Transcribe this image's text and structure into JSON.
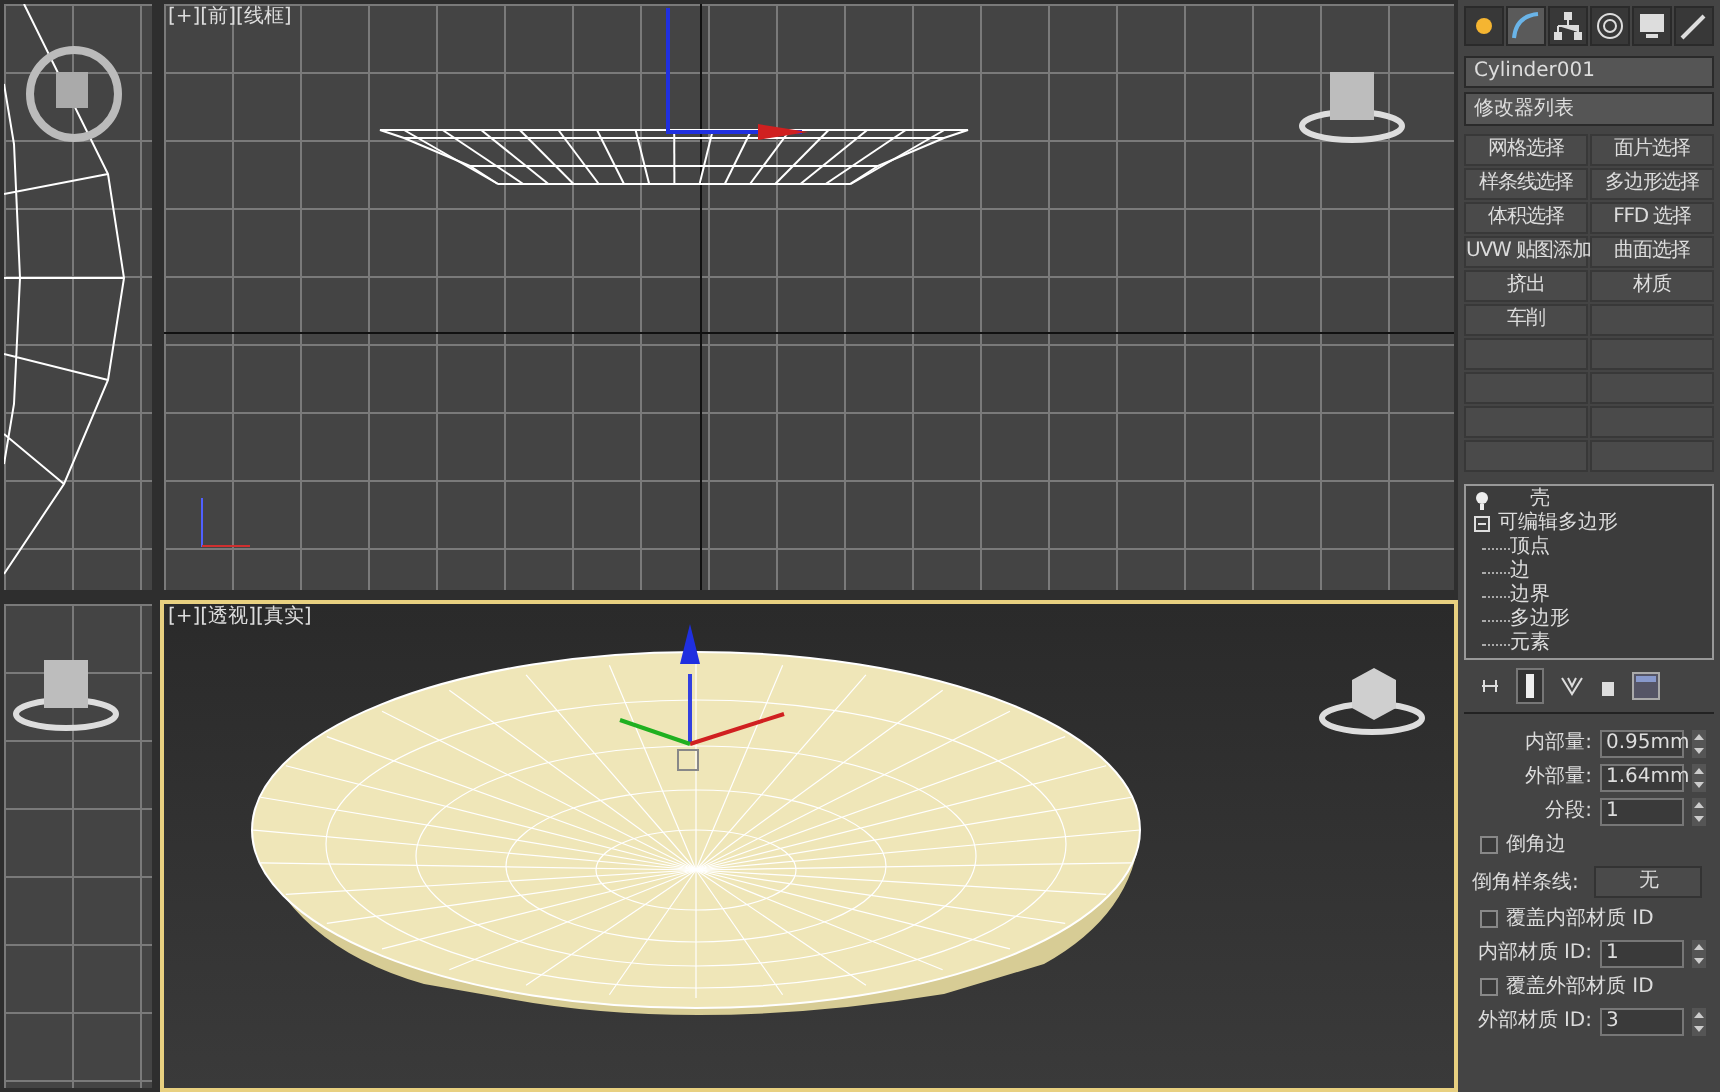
{
  "viewports": [
    {
      "label": "[+][前][线框]",
      "kind": "front",
      "selected": false
    },
    {
      "label": "[+][透视][真实]",
      "kind": "perspective",
      "selected": true
    }
  ],
  "command_tabs": [
    {
      "kind": "create",
      "selected": false
    },
    {
      "kind": "modify",
      "selected": true
    },
    {
      "kind": "hierarchy",
      "selected": false
    },
    {
      "kind": "motion",
      "selected": false
    },
    {
      "kind": "display",
      "selected": false
    },
    {
      "kind": "utilities",
      "selected": false
    }
  ],
  "object_name": "Cylinder001",
  "modifier_list": "修改器列表",
  "modifier_buttons": [
    "网格选择",
    "面片选择",
    "样条线选择",
    "多边形选择",
    "体积选择",
    "FFD 选择",
    "UVW 贴图添加",
    "曲面选择",
    "挤出",
    "材质",
    "车削"
  ],
  "stack": [
    {
      "label": "壳",
      "kind": "modifier"
    },
    {
      "label": "可编辑多边形",
      "kind": "object",
      "expanded": true,
      "children": [
        {
          "label": "顶点"
        },
        {
          "label": "边"
        },
        {
          "label": "边界"
        },
        {
          "label": "多边形"
        },
        {
          "label": "元素"
        }
      ]
    }
  ],
  "parameters": [
    {
      "kind": "spinner",
      "label": "内部量:",
      "value": "0.95mm"
    },
    {
      "kind": "spinner",
      "label": "外部量:",
      "value": "1.64mm"
    },
    {
      "kind": "spinner",
      "label": "分段:",
      "value": "1"
    },
    {
      "kind": "checkbox",
      "label": "倒角边",
      "checked": false
    },
    {
      "kind": "pick",
      "label": "倒角样条线:",
      "value": "无"
    },
    {
      "kind": "checkbox",
      "label": "覆盖内部材质 ID",
      "checked": false
    },
    {
      "kind": "spinner",
      "label": "内部材质 ID:",
      "value": "1"
    },
    {
      "kind": "checkbox",
      "label": "覆盖外部材质 ID",
      "checked": false
    },
    {
      "kind": "spinner",
      "label": "外部材质 ID:",
      "value": "3"
    }
  ]
}
